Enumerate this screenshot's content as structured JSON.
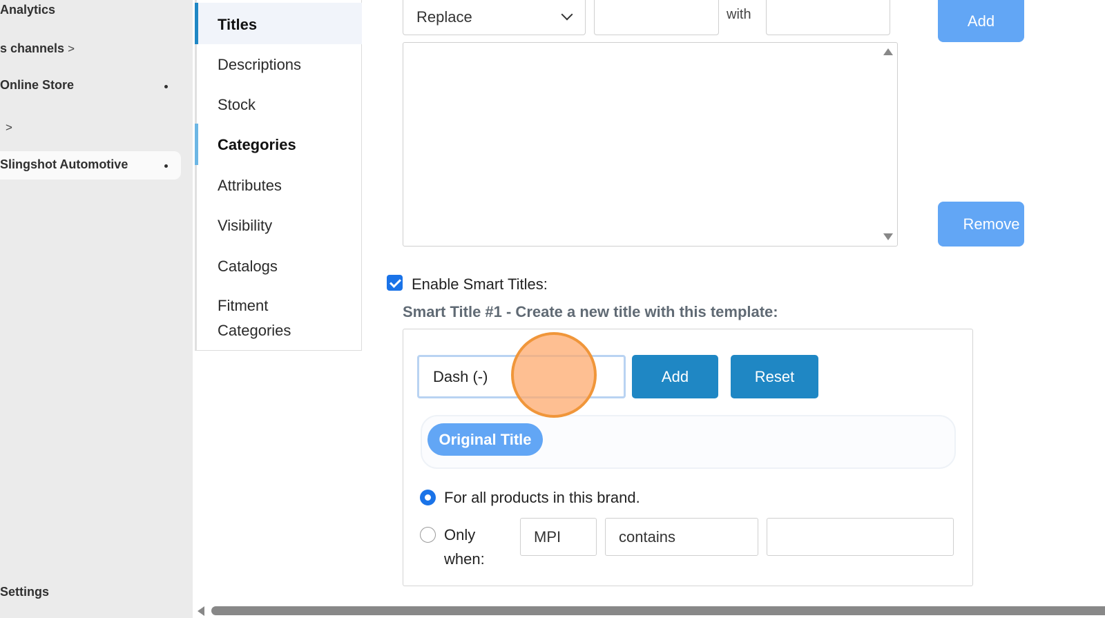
{
  "admin_sidebar": {
    "items": [
      {
        "label": "Analytics"
      },
      {
        "label": "s channels",
        "chevron": ">"
      },
      {
        "label": "Online Store"
      },
      {
        "label": "",
        "chevron": ">"
      },
      {
        "label": "Slingshot Automotive"
      },
      {
        "label": "Settings"
      }
    ]
  },
  "app_menu": {
    "items": [
      {
        "label": "Titles"
      },
      {
        "label": "Descriptions"
      },
      {
        "label": "Stock"
      },
      {
        "label": "Categories"
      },
      {
        "label": "Attributes"
      },
      {
        "label": "Visibility"
      },
      {
        "label": "Catalogs"
      },
      {
        "label": "Fitment"
      },
      {
        "label": "Categories"
      }
    ]
  },
  "replace_row": {
    "select_value": "Replace",
    "with_label": "with",
    "add_label": "Add",
    "remove_label": "Remove"
  },
  "smart_titles": {
    "enable_label": "Enable Smart Titles:",
    "enabled": true,
    "heading": "Smart Title #1 - Create a new title with this template:",
    "separator_value": "Dash (-)",
    "add_label": "Add",
    "reset_label": "Reset",
    "tokens": [
      "Original Title"
    ],
    "option_all": "For all products in this brand.",
    "option_only_line1": "Only",
    "option_only_line2": "when:",
    "selected_option": "all",
    "condition_field": "MPI",
    "condition_operator": "contains",
    "condition_value": ""
  },
  "colors": {
    "light_button": "#62a6f5",
    "dark_button": "#1f87c4",
    "accent": "#1a73e8",
    "cursor": "#f0963a"
  }
}
